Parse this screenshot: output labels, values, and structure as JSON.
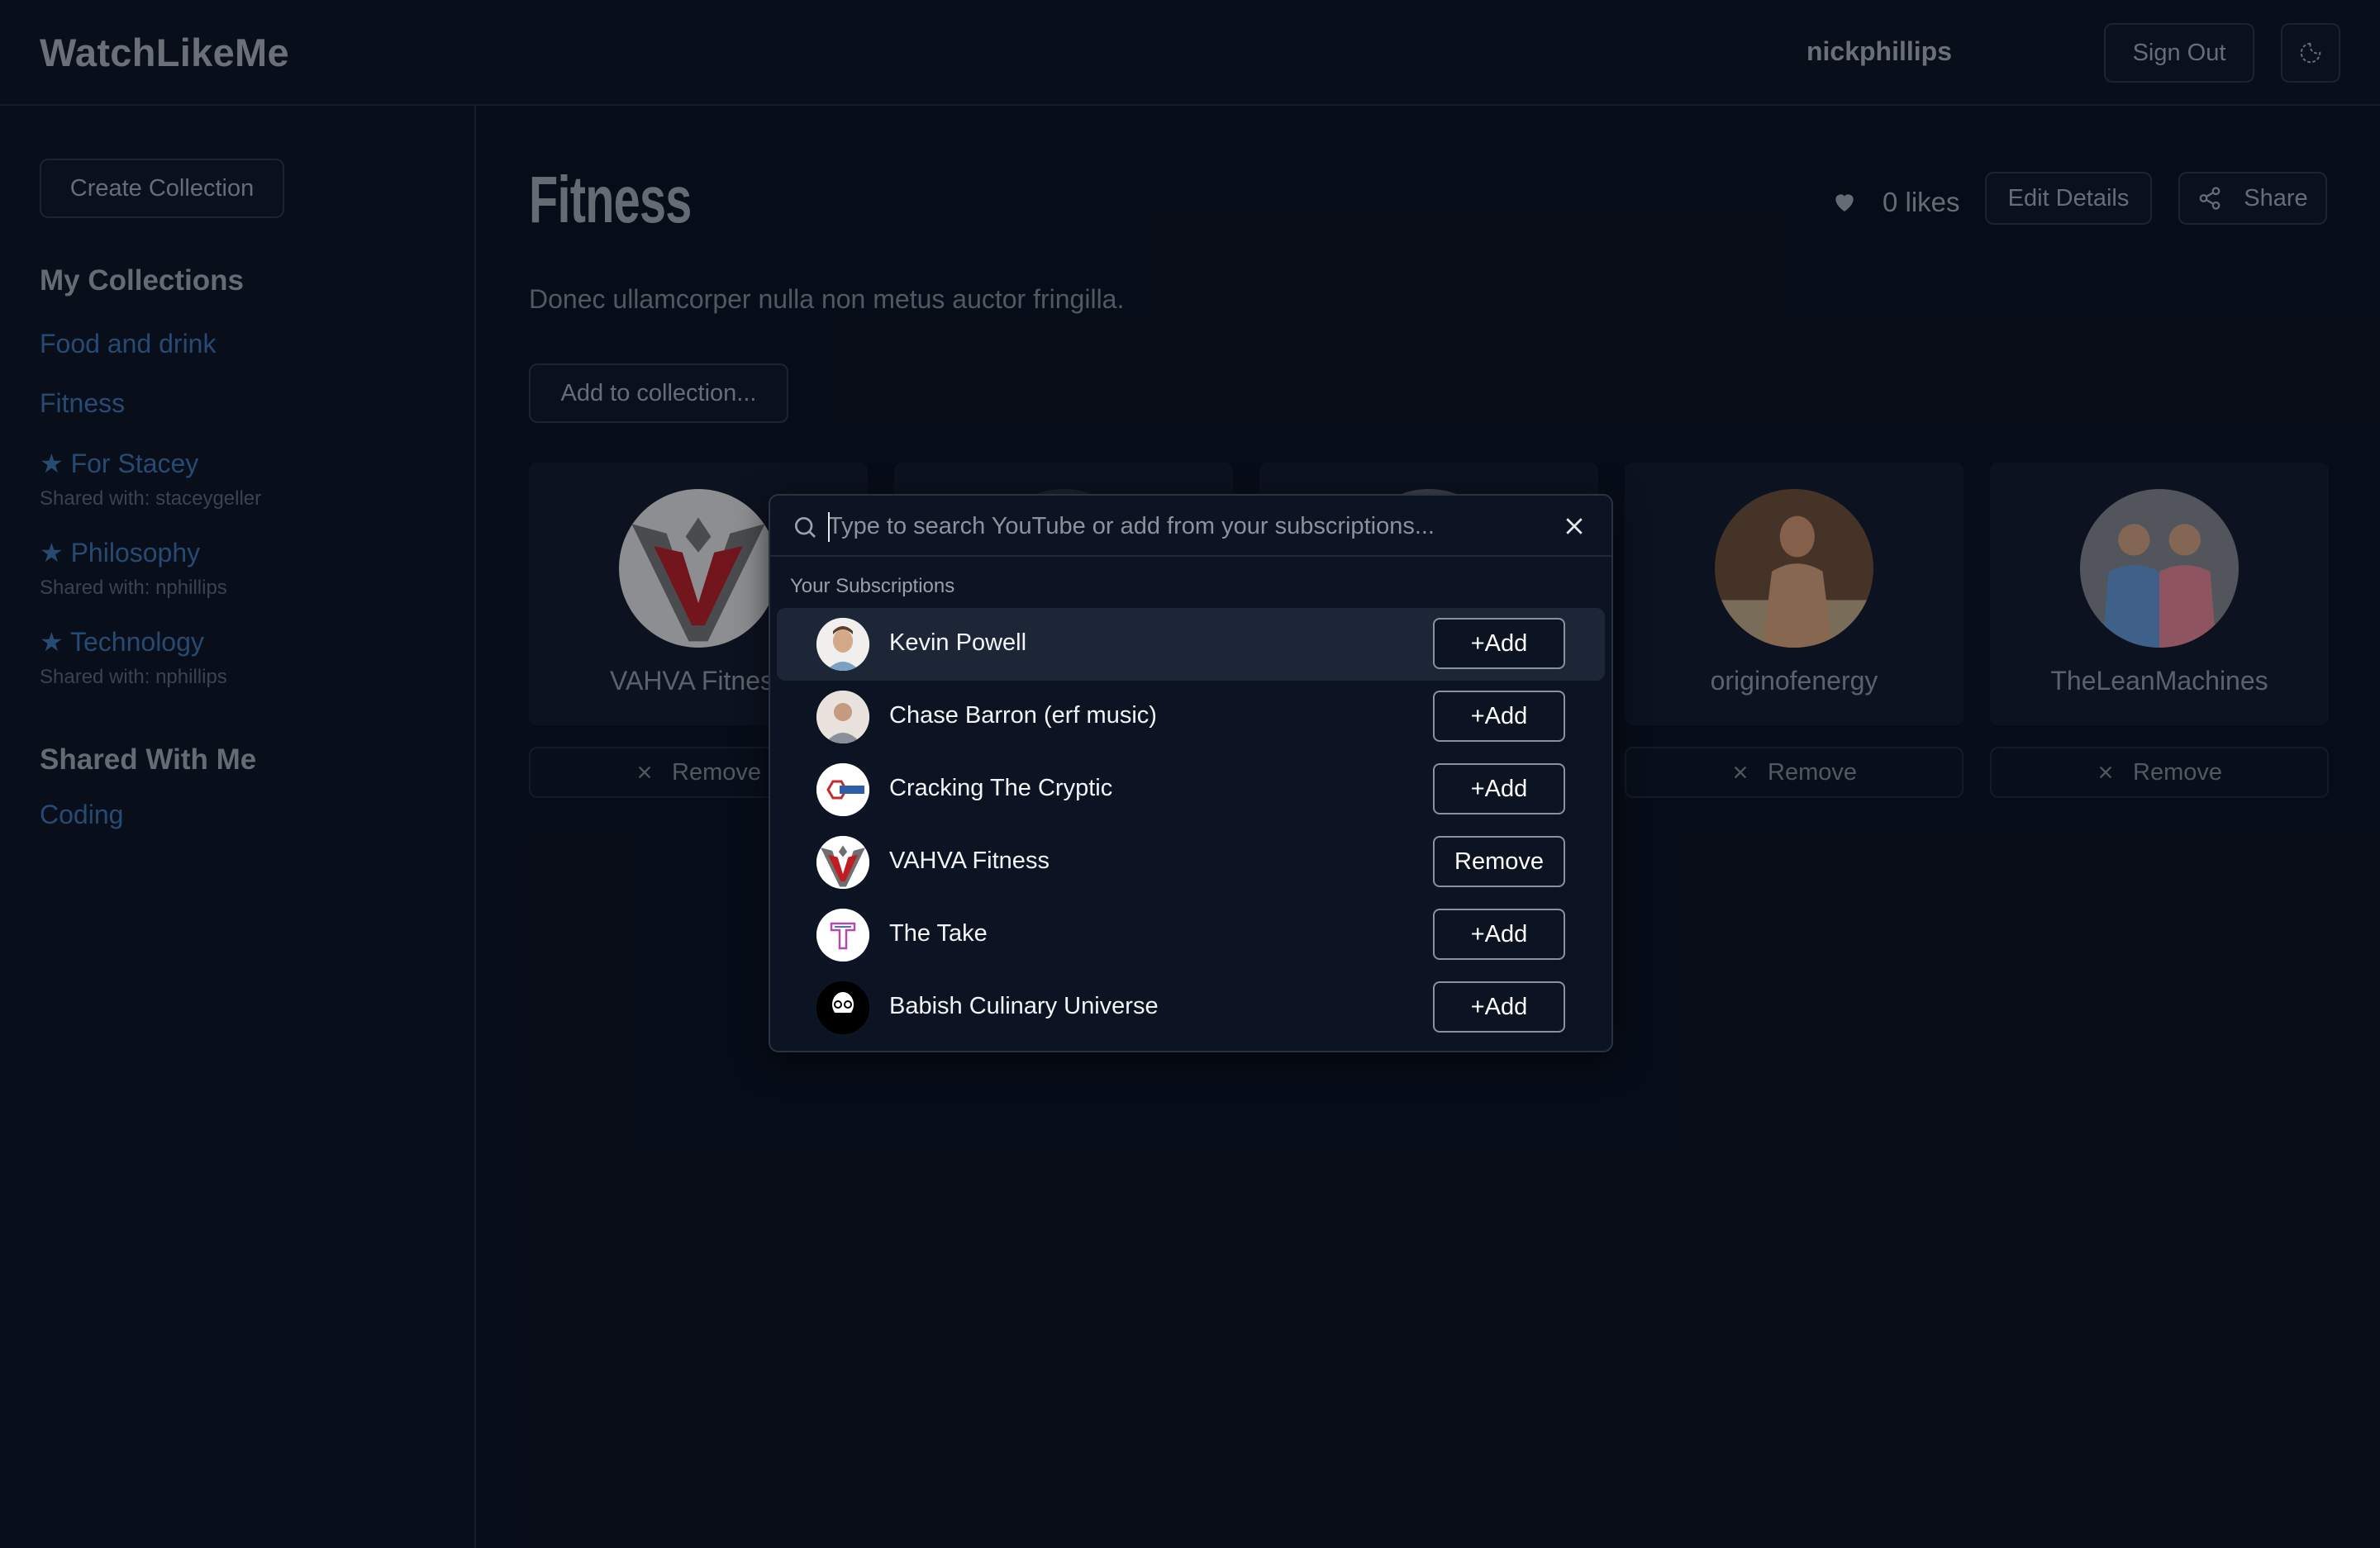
{
  "app": {
    "brand": "WatchLikeMe",
    "username": "nickphillips",
    "sign_out": "Sign Out"
  },
  "sidebar": {
    "create_button": "Create Collection",
    "my_collections_heading": "My Collections",
    "collections": [
      {
        "label": "Food and drink"
      },
      {
        "label": "Fitness"
      },
      {
        "label": "For Stacey",
        "shared": "Shared with: staceygeller"
      },
      {
        "label": "Philosophy",
        "shared": "Shared with: nphillips"
      },
      {
        "label": "Technology",
        "shared": "Shared with: nphillips"
      }
    ],
    "shared_heading": "Shared With Me",
    "shared_collections": [
      {
        "label": "Coding"
      }
    ]
  },
  "main": {
    "title": "Fitness",
    "description": "Donec ullamcorper nulla non metus auctor fringilla.",
    "likes": "0 likes",
    "edit_details": "Edit Details",
    "share": "Share",
    "add_to_collection": "Add to collection...",
    "remove_label": "Remove",
    "cards": [
      {
        "name": "VAHVA Fitness"
      },
      {
        "name": ""
      },
      {
        "name": ""
      },
      {
        "name": "originofenergy"
      },
      {
        "name": "TheLeanMachines"
      }
    ]
  },
  "popup": {
    "search_placeholder": "Type to search YouTube or add from your subscriptions...",
    "subscriptions_heading": "Your Subscriptions",
    "subscriptions": [
      {
        "name": "Kevin Powell",
        "action": "+Add"
      },
      {
        "name": "Chase Barron (erf music)",
        "action": "+Add"
      },
      {
        "name": "Cracking The Cryptic",
        "action": "+Add"
      },
      {
        "name": "VAHVA Fitness",
        "action": "Remove"
      },
      {
        "name": "The Take",
        "action": "+Add"
      },
      {
        "name": "Babish Culinary Universe",
        "action": "+Add"
      }
    ],
    "icons": [
      "search-icon",
      "close-icon"
    ]
  },
  "colors": {
    "background": "#0a101c",
    "link": "#3b6ea8",
    "text_muted": "#9aa0a8"
  }
}
